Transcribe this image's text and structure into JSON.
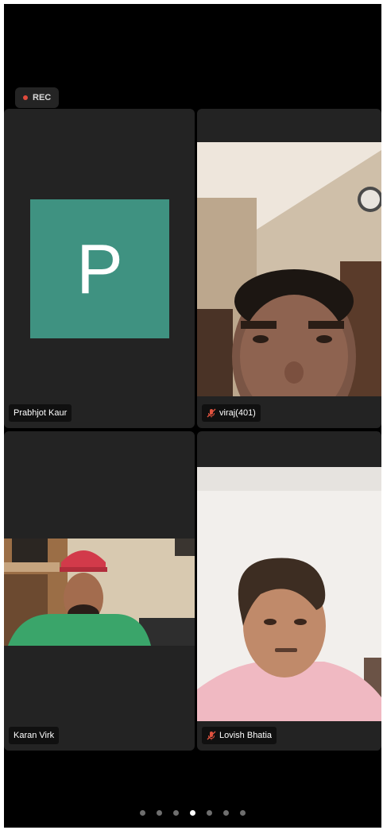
{
  "recording": {
    "label": "REC",
    "dot_color": "#e04a3c"
  },
  "tiles": [
    {
      "name": "Prabhjot Kaur",
      "initial": "P",
      "avatar_color": "#3f9281",
      "muted": false
    },
    {
      "name": "viraj(401)",
      "muted": true
    },
    {
      "name": "Karan Virk",
      "muted": false
    },
    {
      "name": "Lovish Bhatia",
      "muted": true
    }
  ],
  "pager": {
    "total": 7,
    "active_index": 3
  },
  "colors": {
    "muted_icon": "#e0523f",
    "background": "#000000"
  }
}
